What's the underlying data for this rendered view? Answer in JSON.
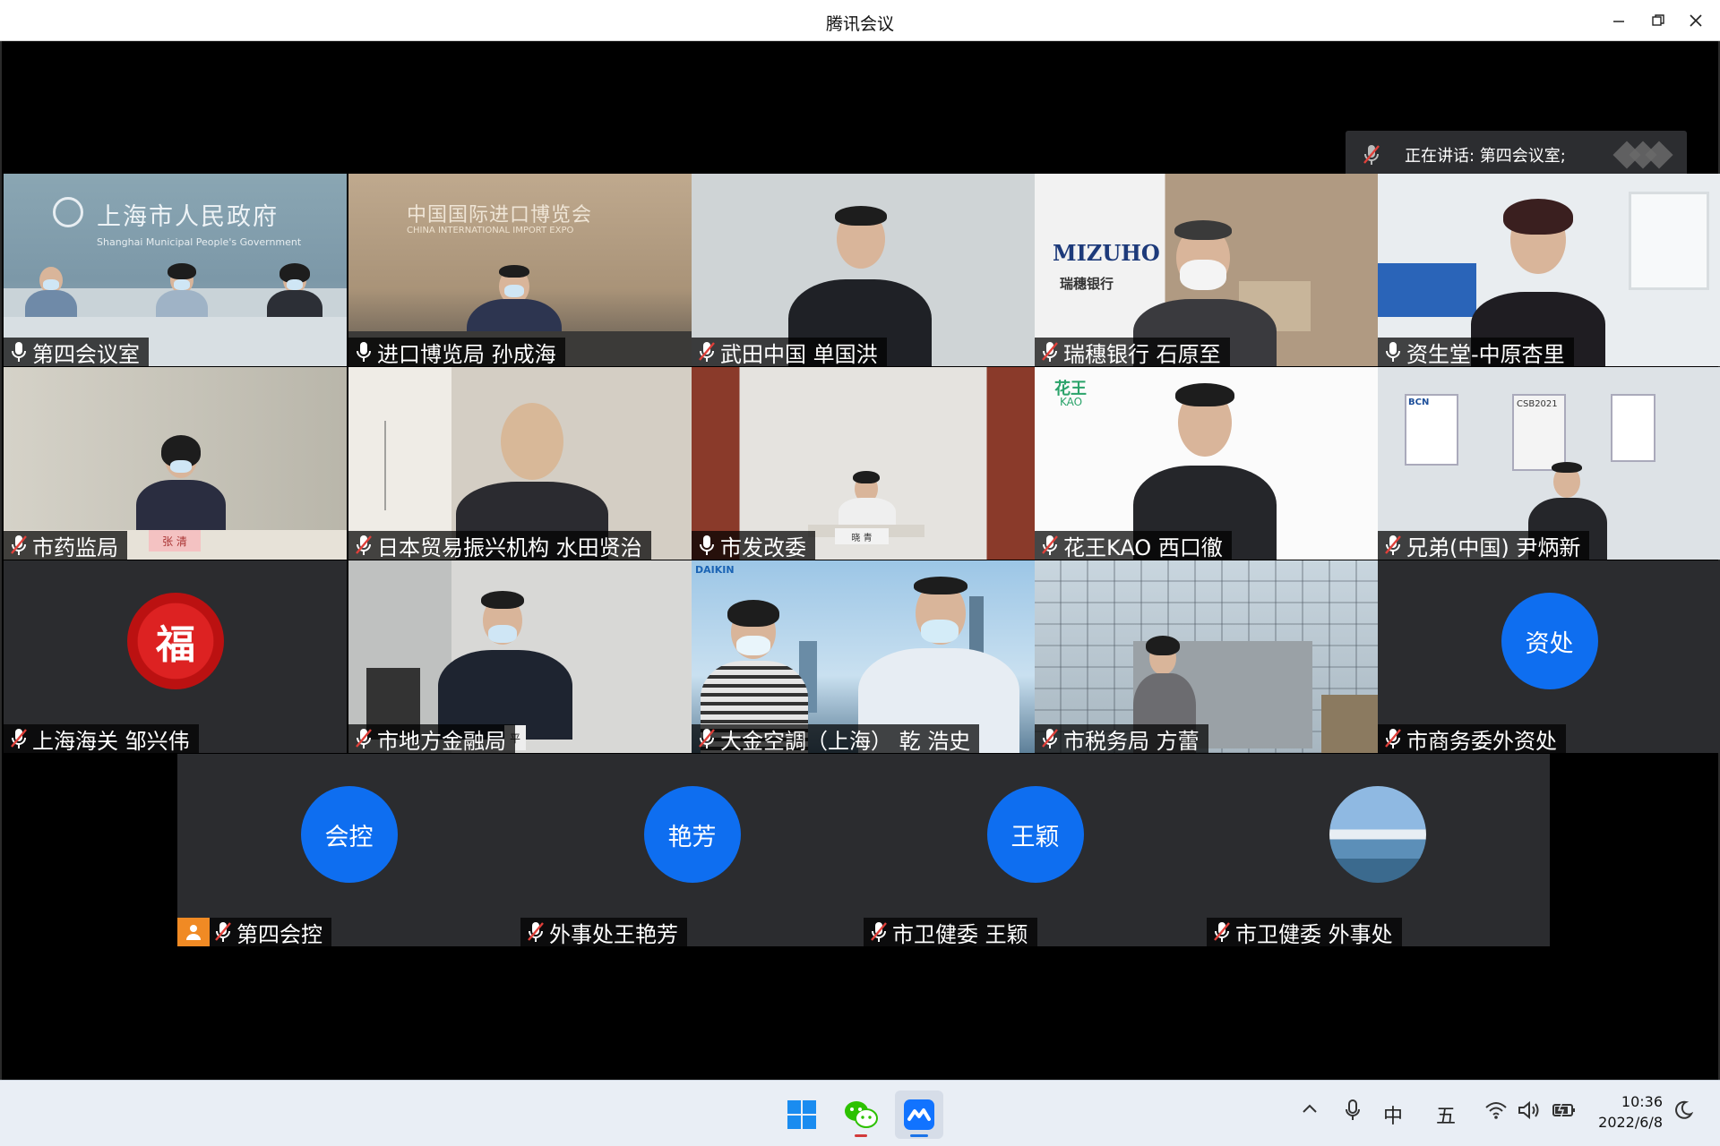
{
  "window": {
    "title": "腾讯会议"
  },
  "speaking": {
    "label": "正在讲话: 第四会议室;"
  },
  "tiles": [
    {
      "name": "第四会议室",
      "muted": false
    },
    {
      "name": "进口博览局 孙成海",
      "muted": false
    },
    {
      "name": "武田中国 单国洪",
      "muted": true
    },
    {
      "name": "瑞穗银行  石原至",
      "muted": true
    },
    {
      "name": "资生堂-中原杏里",
      "muted": false
    },
    {
      "name": "市药监局",
      "muted": true
    },
    {
      "name": "日本贸易振兴机构 水田贤治",
      "muted": true
    },
    {
      "name": "市发改委",
      "muted": false
    },
    {
      "name": "花王KAO 西口徹",
      "muted": true
    },
    {
      "name": "兄弟(中国) 尹炳新",
      "muted": true
    },
    {
      "name": "上海海关 邹兴伟",
      "muted": true
    },
    {
      "name": "市地方金融局",
      "muted": true
    },
    {
      "name": "大金空調（上海）   乾   浩史",
      "muted": true
    },
    {
      "name": "市税务局 方蕾",
      "muted": true
    },
    {
      "name": "市商务委外资处",
      "muted": true
    },
    {
      "name": "第四会控",
      "muted": true
    },
    {
      "name": "外事处王艳芳",
      "muted": true
    },
    {
      "name": "市卫健委 王颖",
      "muted": true
    },
    {
      "name": "市卫健委  外事处",
      "muted": true
    }
  ],
  "avatars": {
    "ziChu": "资处",
    "huiKong": "会控",
    "yanFang": "艳芳",
    "wangYing": "王颖"
  },
  "scene_text": {
    "gov_sign": "上海市人民政府",
    "gov_sign_en": "Shanghai Municipal People's Government",
    "expo_sign": "中国国际进口博览会",
    "expo_sign_en": "CHINA INTERNATIONAL IMPORT EXPO",
    "mizuho": "MIZUHO",
    "mizuho_cn": "瑞穗银行",
    "kao_logo": "花王",
    "kao_en": "KAO",
    "daikin": "DAIKIN",
    "placard_1": "张 清",
    "placard_2": "平",
    "placard_3": "晓 青",
    "fu": "福",
    "bcn": "BCN",
    "csb": "CSB2021"
  },
  "taskbar": {
    "ime_lang": "中",
    "ime_mode": "五",
    "time": "10:36",
    "date": "2022/6/8"
  },
  "colors": {
    "avatar_blue": "#0e6ef0",
    "active_border": "#2ea65d",
    "tile_bg": "#2b2c2f",
    "muted_red": "#e0403a"
  }
}
